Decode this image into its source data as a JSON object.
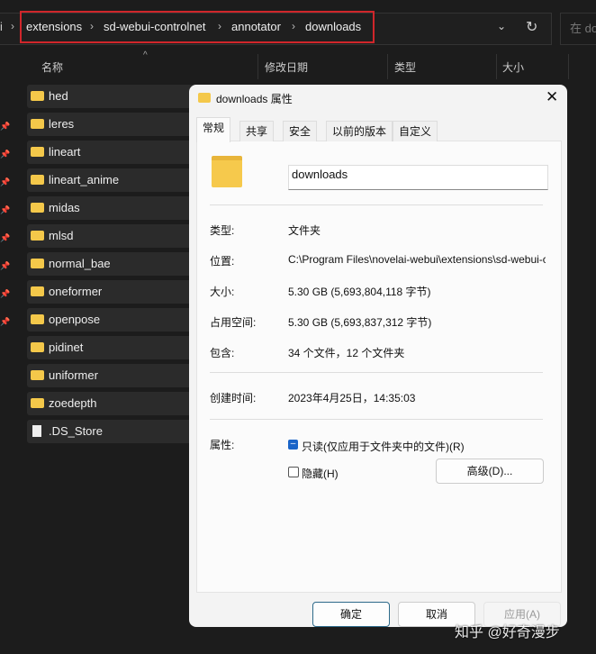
{
  "breadcrumb": {
    "prev": "i",
    "items": [
      "extensions",
      "sd-webui-controlnet",
      "annotator",
      "downloads"
    ]
  },
  "search": {
    "placeholder": "在 do"
  },
  "columns": [
    "名称",
    "修改日期",
    "类型",
    "大小"
  ],
  "files": [
    {
      "name": "hed",
      "type": "folder"
    },
    {
      "name": "leres",
      "type": "folder"
    },
    {
      "name": "lineart",
      "type": "folder"
    },
    {
      "name": "lineart_anime",
      "type": "folder"
    },
    {
      "name": "midas",
      "type": "folder"
    },
    {
      "name": "mlsd",
      "type": "folder"
    },
    {
      "name": "normal_bae",
      "type": "folder"
    },
    {
      "name": "oneformer",
      "type": "folder"
    },
    {
      "name": "openpose",
      "type": "folder"
    },
    {
      "name": "pidinet",
      "type": "folder"
    },
    {
      "name": "uniformer",
      "type": "folder"
    },
    {
      "name": "zoedepth",
      "type": "folder"
    },
    {
      "name": ".DS_Store",
      "type": "file"
    }
  ],
  "dialog": {
    "title": "downloads 属性",
    "tabs": [
      "常规",
      "共享",
      "安全",
      "以前的版本",
      "自定义"
    ],
    "name": "downloads",
    "fields": [
      {
        "label": "类型:",
        "value": "文件夹"
      },
      {
        "label": "位置:",
        "value": "C:\\Program Files\\novelai-webui\\extensions\\sd-webui-controlnet\\annotator"
      },
      {
        "label": "大小:",
        "value": "5.30 GB (5,693,804,118 字节)"
      },
      {
        "label": "占用空间:",
        "value": "5.30 GB (5,693,837,312 字节)"
      },
      {
        "label": "包含:",
        "value": "34 个文件，12 个文件夹"
      }
    ],
    "created_label": "创建时间:",
    "created": "2023年4月25日，14:35:03",
    "attr_label": "属性:",
    "readonly": "只读(仅应用于文件夹中的文件)(R)",
    "hidden": "隐藏(H)",
    "advanced": "高级(D)...",
    "ok": "确定",
    "cancel": "取消",
    "apply": "应用(A)"
  },
  "watermark": "知乎 @好奇漫步"
}
